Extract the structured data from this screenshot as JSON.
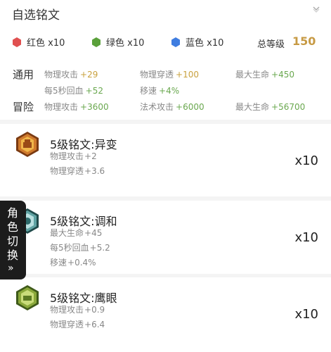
{
  "header": {
    "title": "自选铭文",
    "chevron_icon": "chevron-down-icon"
  },
  "counts": {
    "red": {
      "label": "红色 x10",
      "color": "#e05050",
      "icon": "hexagon-icon"
    },
    "green": {
      "label": "绿色 x10",
      "color": "#5aa03a",
      "icon": "hexagon-icon"
    },
    "blue": {
      "label": "蓝色 x10",
      "color": "#3f7de0",
      "icon": "hexagon-icon"
    },
    "total_level_label": "总等级",
    "total_level_value": "150"
  },
  "stats": {
    "general_label": "通用",
    "general": [
      {
        "name": "物理攻击",
        "value": "+29",
        "color": "gold"
      },
      {
        "name": "物理穿透",
        "value": "+100",
        "color": "gold"
      },
      {
        "name": "最大生命",
        "value": "+450",
        "color": "green"
      },
      {
        "name": "每5秒回血",
        "value": "+52",
        "color": "green"
      },
      {
        "name": "移速",
        "value": "+4%",
        "color": "green"
      }
    ],
    "adventure_label": "冒险",
    "adventure": [
      {
        "name": "物理攻击",
        "value": "+3600",
        "color": "green"
      },
      {
        "name": "法术攻击",
        "value": "+6000",
        "color": "green"
      },
      {
        "name": "最大生命",
        "value": "+56700",
        "color": "green"
      }
    ]
  },
  "inscriptions": [
    {
      "name": "5级铭文:异变",
      "attrs": [
        {
          "name": "物理攻击",
          "value": "+2"
        },
        {
          "name": "物理穿透",
          "value": "+3.6"
        }
      ],
      "qty": "x10",
      "color": "red",
      "icon": "red-inscription-emblem-icon"
    },
    {
      "name": "5级铭文:调和",
      "attrs": [
        {
          "name": "最大生命",
          "value": "+45"
        },
        {
          "name": "每5秒回血",
          "value": "+5.2"
        },
        {
          "name": "移速",
          "value": "+0.4%"
        }
      ],
      "qty": "x10",
      "color": "blue",
      "icon": "blue-inscription-emblem-icon"
    },
    {
      "name": "5级铭文:鹰眼",
      "attrs": [
        {
          "name": "物理攻击",
          "value": "+0.9"
        },
        {
          "name": "物理穿透",
          "value": "+6.4"
        }
      ],
      "qty": "x10",
      "color": "green",
      "icon": "green-inscription-emblem-icon"
    }
  ],
  "side_tab": {
    "chars": [
      "角",
      "色",
      "切",
      "换"
    ],
    "arrow": "»"
  }
}
